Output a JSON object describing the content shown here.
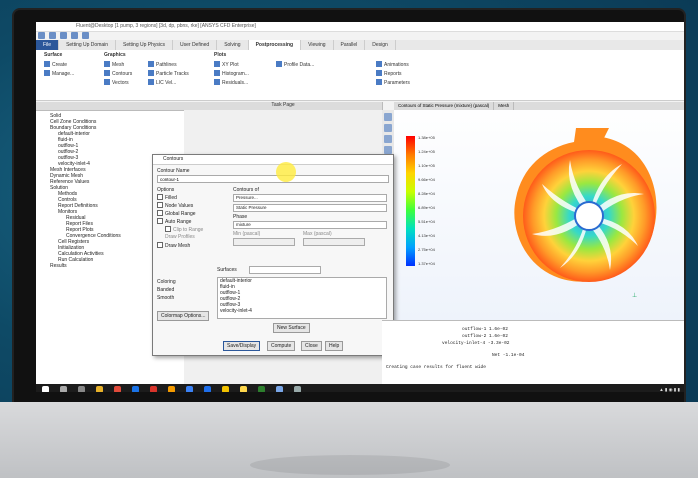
{
  "window": {
    "title": "Fluent@Desktop [1 pump, 3 regions] [3d, dp, pbns, rke] [ANSYS CFD Enterprise]"
  },
  "ribbon_tabs": [
    "File",
    "Setting Up Domain",
    "Setting Up Physics",
    "User Defined",
    "Solving",
    "Postprocessing",
    "Viewing",
    "Parallel",
    "Design"
  ],
  "ribbon": {
    "groups": [
      {
        "title": "Surface",
        "items": [
          "Create",
          "Manage..."
        ]
      },
      {
        "title": "Graphics",
        "items": [
          "Mesh",
          "Contours",
          "Vectors",
          "Pathlines",
          "Particle Tracks",
          "LIC Vel..."
        ]
      },
      {
        "title": "Plots",
        "items": [
          "XY Plot",
          "Histogram...",
          "Residuals...",
          "Profile Data..."
        ]
      },
      {
        "title": "",
        "items": [
          "Animations",
          "Reports",
          "Parameters"
        ]
      }
    ]
  },
  "tree": {
    "items": [
      "Solid",
      "Cell Zone Conditions",
      "Boundary Conditions",
      "Mesh Interfaces",
      "Dynamic Mesh",
      "Reference Values",
      "Solution",
      "Methods",
      "Controls",
      "Report Definitions",
      "Monitors",
      "Residual",
      "Report Files",
      "Report Plots",
      "Convergence Conditions",
      "Cell Registers",
      "Initialization",
      "Calculation Activities",
      "Run Calculation",
      "Results"
    ]
  },
  "task_page": {
    "title": "Task Page"
  },
  "contours_dialog": {
    "title": "Contours",
    "contour_name_label": "Contour Name",
    "contour_name_value": "contour-1",
    "options_label": "Options",
    "options": [
      "Filled",
      "Node Values",
      "Global Range",
      "Auto Range",
      "Clip to Range",
      "Draw Profiles",
      "Draw Mesh"
    ],
    "contours_of_label": "Contours of",
    "contours_of_value": "Pressure...",
    "sub_value": "Static Pressure",
    "phase_label": "Phase",
    "phase_value": "mixture",
    "min_label": "Min (pascal)",
    "max_label": "Max (pascal)",
    "surfaces_label": "Surfaces",
    "surfaces": [
      "default-interior",
      "fluid-in",
      "outflow-1",
      "outflow-2",
      "outflow-3",
      "velocity-inlet-4"
    ],
    "coloring_label": "Coloring",
    "coloring_options": [
      "Banded",
      "Smooth"
    ],
    "colormap_button": "Colormap Options...",
    "new_surface": "New Surface",
    "buttons": [
      "Save/Display",
      "Compute",
      "Close",
      "Help"
    ]
  },
  "graphics": {
    "tabs": [
      "Contours of Static Pressure (mixture) (pascal)",
      "Mesh"
    ],
    "colorbar_labels": [
      "1.38e+05",
      "1.24e+05",
      "1.10e+05",
      "9.66e+04",
      "8.28e+04",
      "6.89e+04",
      "5.51e+04",
      "4.13e+04",
      "2.75e+04",
      "1.37e+04"
    ]
  },
  "console": {
    "lines": [
      "outflow-1   1.6e-02",
      "outflow-2   1.6e-02",
      "velocity-inlet-4   -3.3e-02",
      "Net   -1.1e-04",
      "Creating case results for fluent wide"
    ]
  },
  "colors": {
    "accent": "#2b579a",
    "taskbar": "#1c1c1c"
  }
}
